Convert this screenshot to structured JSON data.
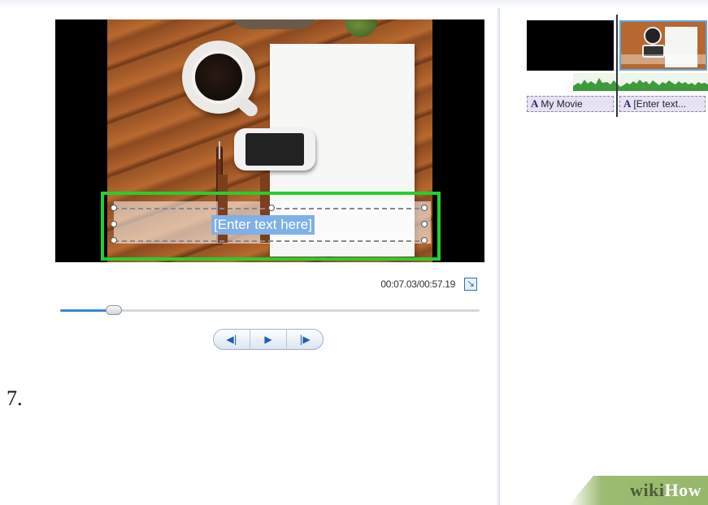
{
  "preview": {
    "caption_text": "[Enter text here]"
  },
  "playback": {
    "time_readout": "00:07.03/00:57.19",
    "seek_progress": 0.14,
    "fullscreen_icon": "expand-arrow-icon",
    "buttons": {
      "previous_frame": "◀|",
      "play": "▶",
      "next_frame": "|▶"
    }
  },
  "storyboard": {
    "title_icon": "A",
    "titles": [
      {
        "label": "My Movie"
      },
      {
        "label": "[Enter text..."
      }
    ]
  },
  "step_label": "7.",
  "watermark": {
    "part1": "wiki",
    "part2": "How"
  },
  "colors": {
    "highlight": "#22d12a",
    "accent": "#3a86d6",
    "title_chip": "#e7e1f3"
  }
}
